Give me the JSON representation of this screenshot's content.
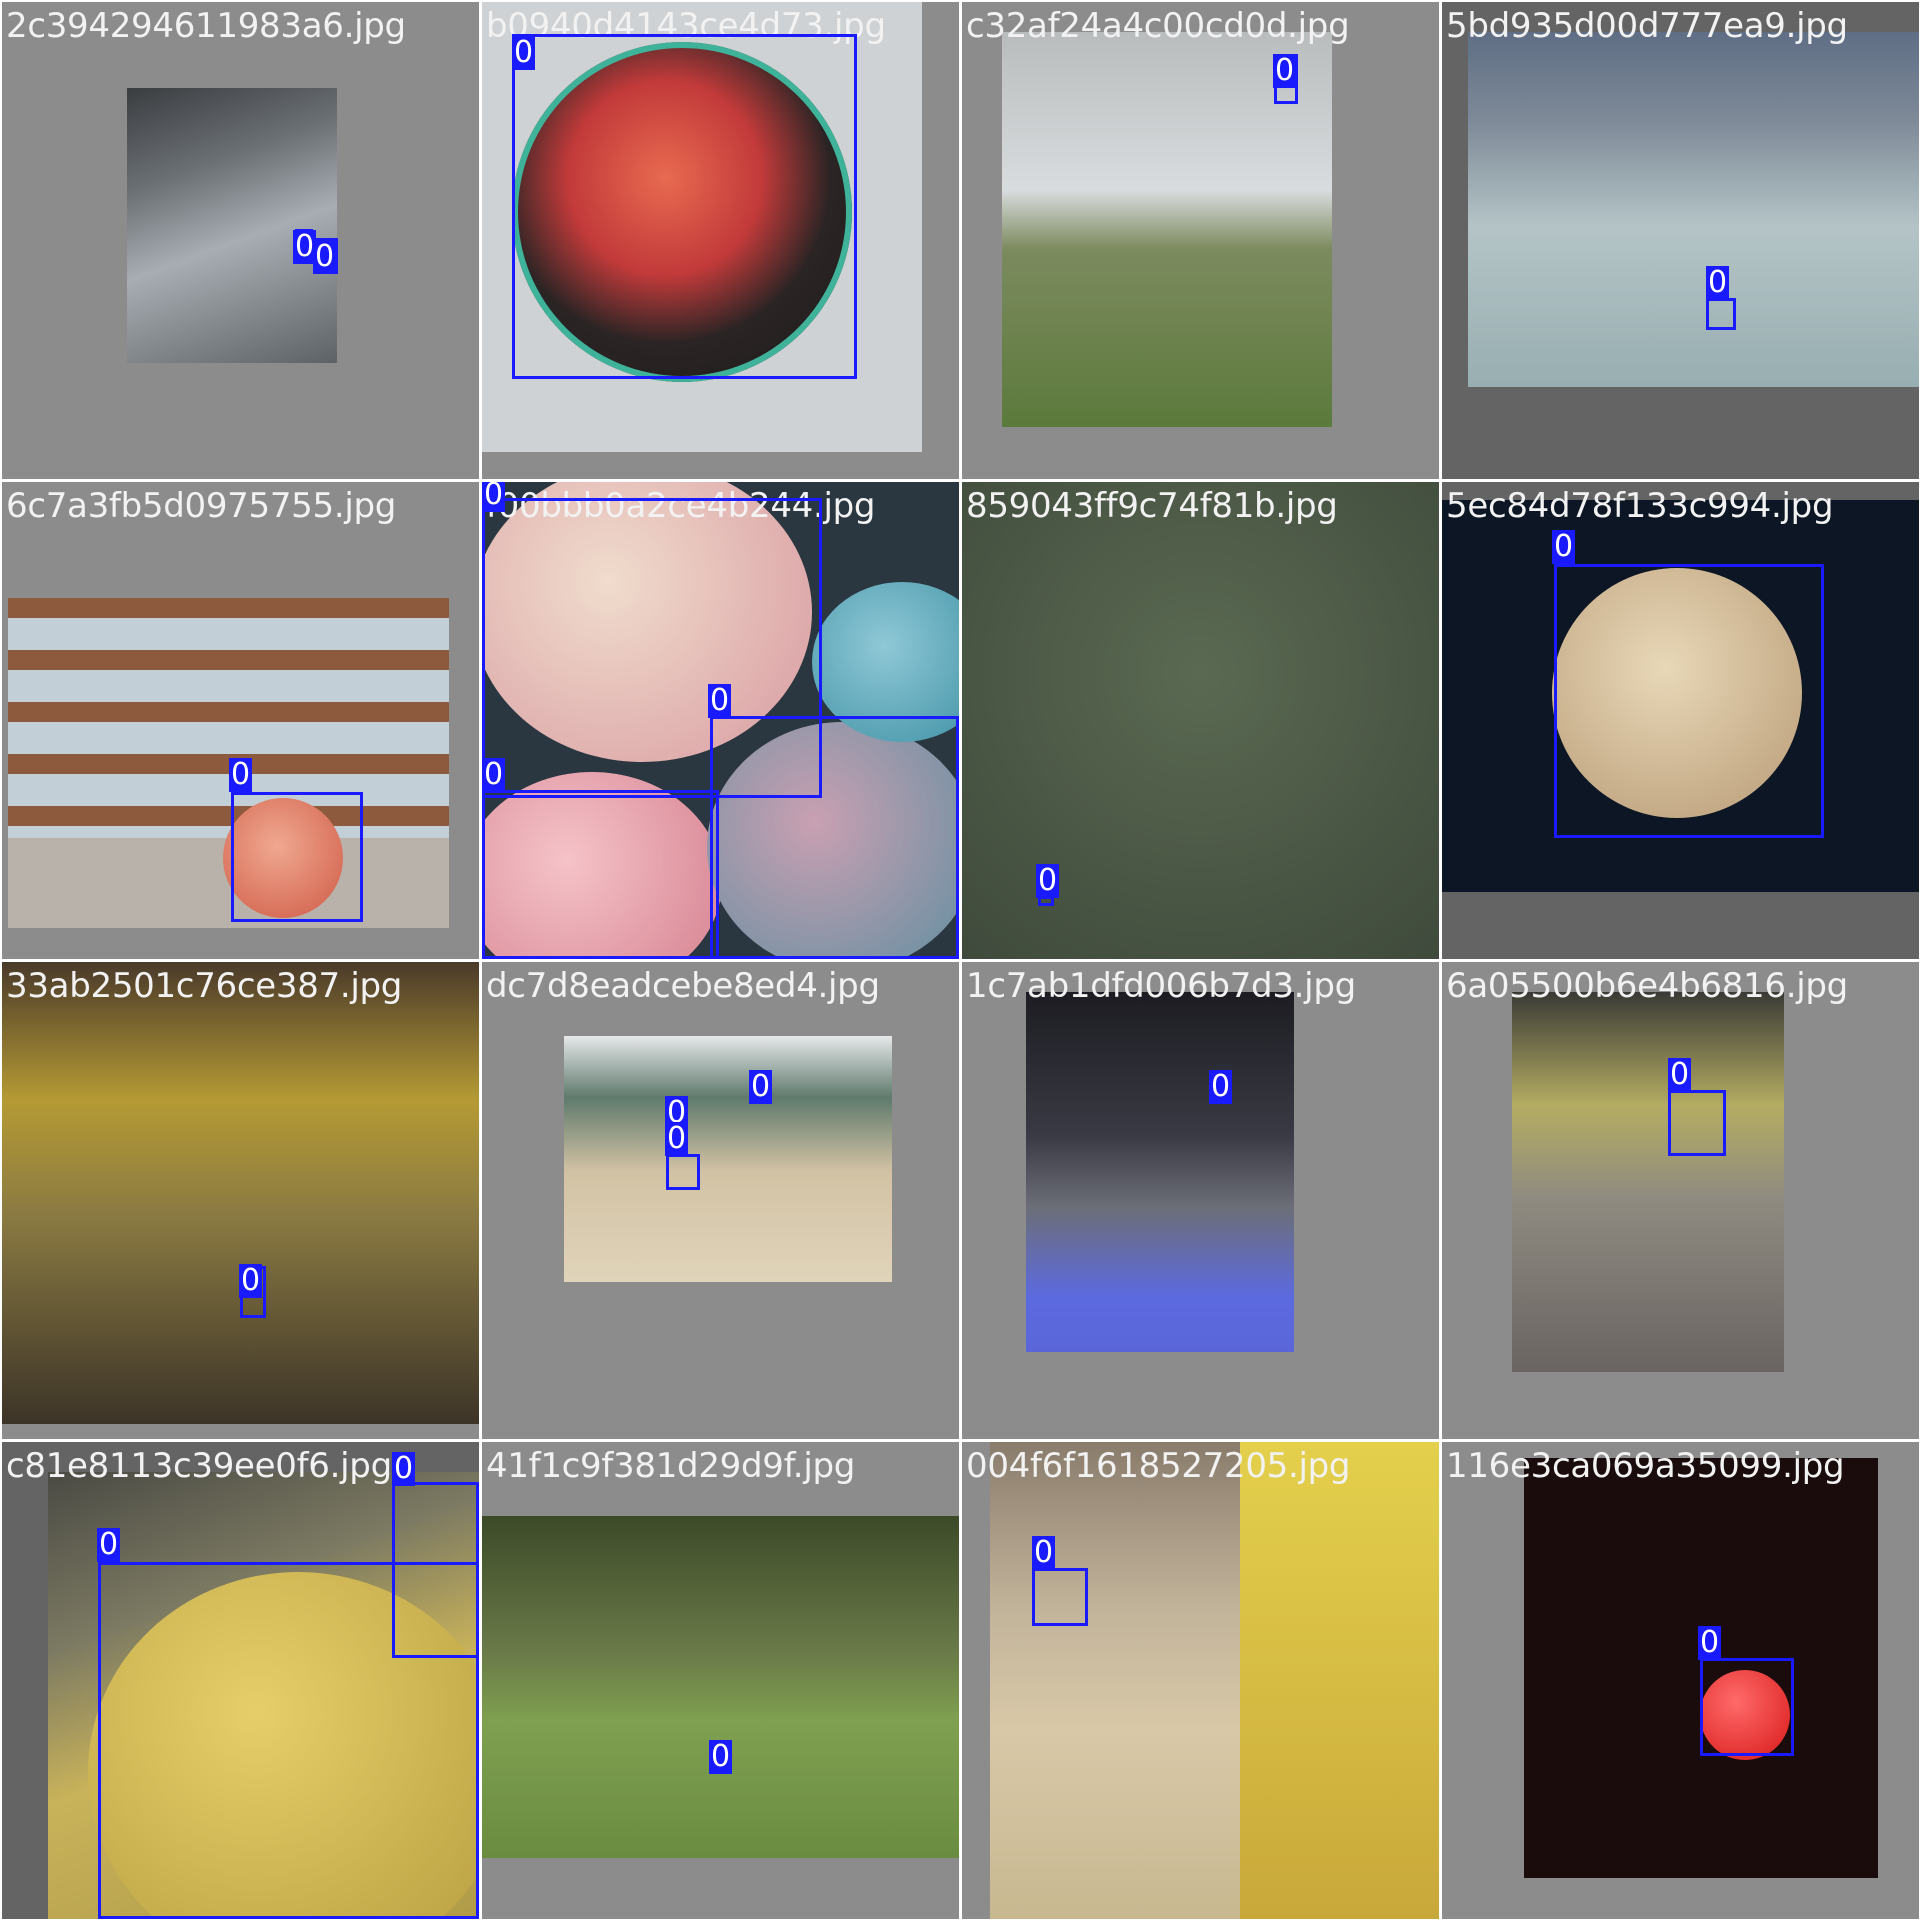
{
  "mosaic": {
    "tiles": [
      {
        "filename": "2c394294611983a6.jpg",
        "labels": [
          "0",
          "0"
        ]
      },
      {
        "filename": "b0940d4143ce4d73.jpg",
        "labels": [
          "0"
        ]
      },
      {
        "filename": "c32af24a4c00cd0d.jpg",
        "labels": [
          "0"
        ]
      },
      {
        "filename": "5bd935d00d777ea9.jpg",
        "labels": [
          "0"
        ]
      },
      {
        "filename": "6c7a3fb5d0975755.jpg",
        "labels": [
          "0"
        ]
      },
      {
        "filename": "f00bbb0a2ce4b244.jpg",
        "labels": [
          "0",
          "0",
          "0"
        ]
      },
      {
        "filename": "859043ff9c74f81b.jpg",
        "labels": [
          "0"
        ]
      },
      {
        "filename": "5ec84d78f133c994.jpg",
        "labels": [
          "0"
        ]
      },
      {
        "filename": "33ab2501c76ce387.jpg",
        "labels": [
          "0"
        ]
      },
      {
        "filename": "dc7d8eadcebe8ed4.jpg",
        "labels": [
          "0",
          "0",
          "0"
        ]
      },
      {
        "filename": "1c7ab1dfd006b7d3.jpg",
        "labels": [
          "0"
        ]
      },
      {
        "filename": "6a05500b6e4b6816.jpg",
        "labels": [
          "0"
        ]
      },
      {
        "filename": "c81e8113c39ee0f6.jpg",
        "labels": [
          "0",
          "0"
        ]
      },
      {
        "filename": "41f1c9f381d29d9f.jpg",
        "labels": [
          "0"
        ]
      },
      {
        "filename": "004f6f1618527205.jpg",
        "labels": [
          "0"
        ]
      },
      {
        "filename": "116e3ca069a35099.jpg",
        "labels": [
          "0"
        ]
      }
    ]
  },
  "colors": {
    "box": "#1a1aff",
    "padding_gray": "#8c8c8c",
    "padding_dark": "#646464",
    "filename_text": "#f2f2f2"
  }
}
